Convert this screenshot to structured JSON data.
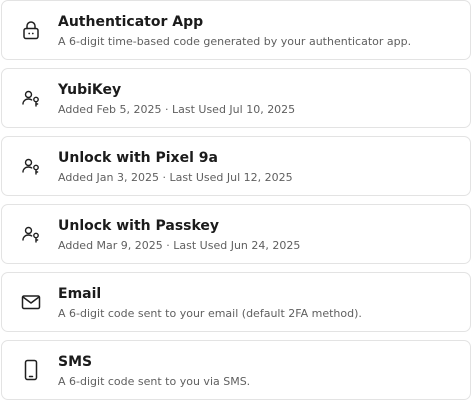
{
  "methods": [
    {
      "icon": "lock-icon",
      "title": "Authenticator App",
      "subtitle": "A 6-digit time-based code generated by your authenticator app."
    },
    {
      "icon": "user-key-icon",
      "title": "YubiKey",
      "subtitle": "Added Feb 5, 2025 · Last Used Jul 10, 2025"
    },
    {
      "icon": "user-key-icon",
      "title": "Unlock with Pixel 9a",
      "subtitle": "Added Jan 3, 2025 · Last Used Jul 12, 2025"
    },
    {
      "icon": "user-key-icon",
      "title": "Unlock with Passkey",
      "subtitle": "Added Mar 9, 2025 · Last Used Jun 24, 2025"
    },
    {
      "icon": "envelope-icon",
      "title": "Email",
      "subtitle": "A 6-digit code sent to your email (default 2FA method)."
    },
    {
      "icon": "smartphone-icon",
      "title": "SMS",
      "subtitle": "A 6-digit code sent to you via SMS."
    }
  ]
}
